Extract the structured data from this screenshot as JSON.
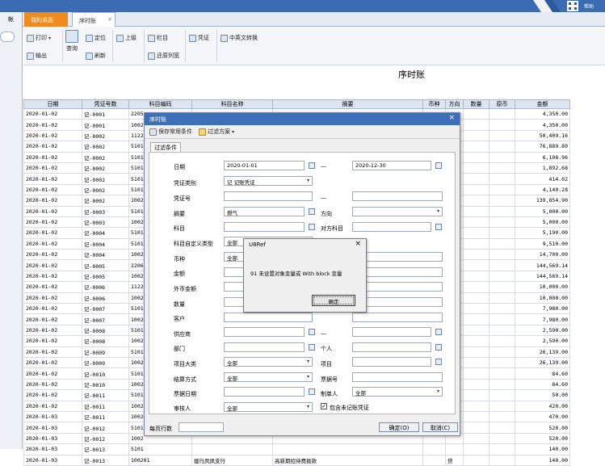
{
  "tabs": {
    "desktop": "我的桌面",
    "ledger": "序时账",
    "close": "×"
  },
  "left_fragment": "帐",
  "topright_fragment": "帮助",
  "ribbon": {
    "print": "打印",
    "output": "输出",
    "query": "查询",
    "locate": "定位",
    "refresh": "刷新",
    "up": "上级",
    "columns": "栏目",
    "restore": "还原列宽",
    "voucher": "凭证",
    "cn_en": "中英文转换"
  },
  "report_title": "序时账",
  "grid": {
    "headers": [
      "日期",
      "凭证号数",
      "科目编码",
      "科目名称",
      "摘要",
      "币种",
      "方向",
      "数量",
      "原币",
      "金额"
    ],
    "rows": [
      [
        "2020-01-02",
        "记-0001",
        "2205",
        "",
        "",
        "",
        "",
        "",
        "",
        "4,350.00"
      ],
      [
        "2020-01-02",
        "记-0001",
        "1002",
        "",
        "",
        "",
        "",
        "",
        "",
        "4,350.00"
      ],
      [
        "2020-01-02",
        "记-0002",
        "1122",
        "",
        "",
        "",
        "",
        "",
        "",
        "50,409.16"
      ],
      [
        "2020-01-02",
        "记-0002",
        "5101",
        "",
        "",
        "",
        "",
        "",
        "",
        "76,889.80"
      ],
      [
        "2020-01-02",
        "记-0002",
        "5101",
        "",
        "",
        "",
        "",
        "",
        "",
        "6,108.96"
      ],
      [
        "2020-01-02",
        "记-0002",
        "5101",
        "",
        "",
        "",
        "",
        "",
        "",
        "1,892.68"
      ],
      [
        "2020-01-02",
        "记-0002",
        "5101",
        "",
        "",
        "",
        "",
        "",
        "",
        "414.02"
      ],
      [
        "2020-01-02",
        "记-0002",
        "5101",
        "",
        "",
        "",
        "",
        "",
        "",
        "4,140.28"
      ],
      [
        "2020-01-02",
        "记-0002",
        "1002",
        "",
        "",
        "",
        "",
        "",
        "",
        "139,854.90"
      ],
      [
        "2020-01-02",
        "记-0003",
        "5101",
        "",
        "",
        "",
        "",
        "",
        "",
        "5,000.00"
      ],
      [
        "2020-01-02",
        "记-0003",
        "1002",
        "",
        "",
        "",
        "",
        "",
        "",
        "5,000.00"
      ],
      [
        "2020-01-02",
        "记-0004",
        "5101",
        "",
        "",
        "",
        "",
        "",
        "",
        "5,190.00"
      ],
      [
        "2020-01-02",
        "记-0004",
        "5101",
        "",
        "",
        "",
        "",
        "",
        "",
        "9,510.00"
      ],
      [
        "2020-01-02",
        "记-0004",
        "1002",
        "",
        "",
        "",
        "",
        "",
        "",
        "14,700.00"
      ],
      [
        "2020-01-02",
        "记-0005",
        "2206",
        "",
        "",
        "",
        "",
        "",
        "",
        "144,569.14"
      ],
      [
        "2020-01-02",
        "记-0005",
        "1002",
        "",
        "",
        "",
        "",
        "",
        "",
        "144,569.14"
      ],
      [
        "2020-01-02",
        "记-0006",
        "1122",
        "",
        "",
        "",
        "",
        "",
        "",
        "10,000.00"
      ],
      [
        "2020-01-02",
        "记-0006",
        "1002",
        "",
        "",
        "",
        "",
        "",
        "",
        "10,000.00"
      ],
      [
        "2020-01-02",
        "记-0007",
        "5101",
        "",
        "",
        "",
        "",
        "",
        "",
        "7,980.00"
      ],
      [
        "2020-01-02",
        "记-0007",
        "1002",
        "",
        "",
        "",
        "",
        "",
        "",
        "7,980.00"
      ],
      [
        "2020-01-02",
        "记-0008",
        "5101",
        "",
        "",
        "",
        "",
        "",
        "",
        "2,590.00"
      ],
      [
        "2020-01-02",
        "记-0008",
        "1002",
        "",
        "",
        "",
        "",
        "",
        "",
        "2,590.00"
      ],
      [
        "2020-01-02",
        "记-0009",
        "5101",
        "",
        "",
        "",
        "",
        "",
        "",
        "26,139.00"
      ],
      [
        "2020-01-02",
        "记-0009",
        "1002",
        "",
        "",
        "",
        "",
        "",
        "",
        "26,139.00"
      ],
      [
        "2020-01-02",
        "记-0010",
        "5101",
        "",
        "",
        "",
        "",
        "",
        "",
        "84.60"
      ],
      [
        "2020-01-02",
        "记-0010",
        "1002",
        "",
        "",
        "",
        "",
        "",
        "",
        "84.60"
      ],
      [
        "2020-01-02",
        "记-0011",
        "5101",
        "",
        "",
        "",
        "",
        "",
        "",
        "50.00"
      ],
      [
        "2020-01-02",
        "记-0011",
        "1002",
        "",
        "",
        "",
        "",
        "",
        "",
        "420.00"
      ],
      [
        "2020-01-03",
        "记-0011",
        "1002",
        "",
        "",
        "",
        "",
        "",
        "",
        "470.00"
      ],
      [
        "2020-01-03",
        "记-0012",
        "5101",
        "",
        "",
        "",
        "",
        "",
        "",
        "520.00"
      ],
      [
        "2020-01-03",
        "记-0012",
        "1002",
        "",
        "",
        "",
        "",
        "",
        "",
        "520.00"
      ],
      [
        "2020-01-03",
        "记-0013",
        "5101",
        "",
        "",
        "",
        "",
        "",
        "",
        "140.00"
      ],
      [
        "2020-01-03",
        "记-0013",
        "100201",
        "建行凤凤支行",
        "高新期招待费拨款",
        "",
        "贷",
        "",
        "",
        "140.00"
      ]
    ]
  },
  "dialog": {
    "title": "序时账",
    "close": "×",
    "save_common": "保存常用条件",
    "filter_plan": "过滤方案",
    "tab": "过滤条件",
    "labels": {
      "date": "日期",
      "dash": "—",
      "voucher_type": "凭证类别",
      "voucher_no": "凭证号",
      "summary": "摘要",
      "direction": "方向",
      "account": "科目",
      "counter_account": "对方科目",
      "custom_type": "科目自定义类型",
      "currency": "币种",
      "amount": "金额",
      "fc_amount": "外币金额",
      "quantity": "数量",
      "customer": "客户",
      "supplier": "供应商",
      "department": "部门",
      "person": "个人",
      "project_class": "项目大类",
      "project": "项目",
      "settlement": "结算方式",
      "bill_no": "票据号",
      "bill_date": "票据日期",
      "maker": "制单人",
      "reviewer": "审核人",
      "include_unposted": "包含未记账凭证",
      "per_page": "每页行数"
    },
    "values": {
      "date_from": "2020-01-01",
      "date_to": "2020-12-30",
      "voucher_type": "记 记账凭证",
      "summary": "燃气",
      "custom_type": "全部",
      "currency": "全部",
      "project_class": "全部",
      "settlement": "全部",
      "maker": "全部",
      "reviewer": "全部"
    },
    "ok": "确定(O)",
    "cancel": "取消(C)"
  },
  "message_box": {
    "title": "U8Ref",
    "close": "×",
    "text": "91 未设置对象变量或 With block 变量",
    "ok": "确定"
  }
}
